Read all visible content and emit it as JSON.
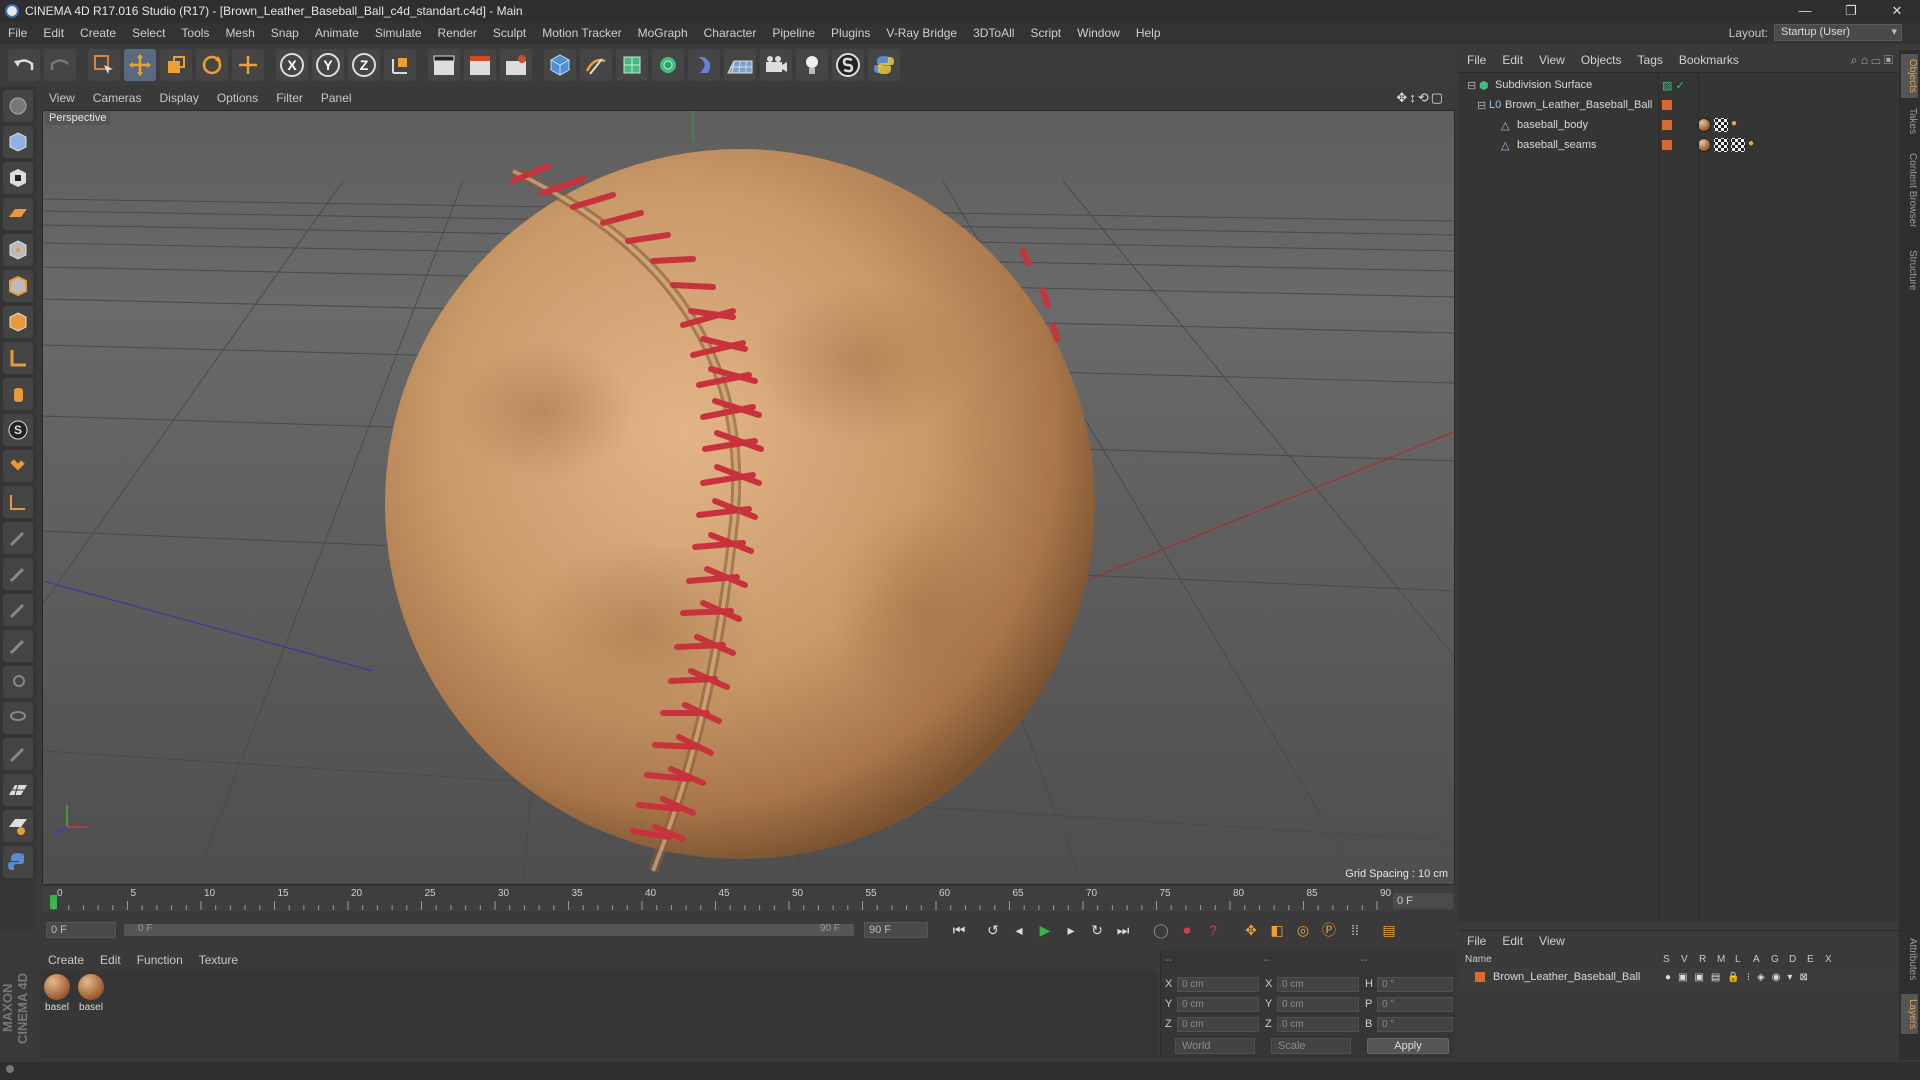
{
  "window": {
    "title": "CINEMA 4D R17.016 Studio (R17) - [Brown_Leather_Baseball_Ball_c4d_standart.c4d] - Main",
    "controls": [
      "—",
      "❐",
      "✕"
    ]
  },
  "menubar": {
    "items": [
      "File",
      "Edit",
      "Create",
      "Select",
      "Tools",
      "Mesh",
      "Snap",
      "Animate",
      "Simulate",
      "Render",
      "Sculpt",
      "Motion Tracker",
      "MoGraph",
      "Character",
      "Pipeline",
      "Plugins",
      "V-Ray Bridge",
      "3DToAll",
      "Script",
      "Window",
      "Help"
    ],
    "layout_label": "Layout:",
    "layout_value": "Startup (User)"
  },
  "toolbar": {
    "axis_x": "X",
    "axis_y": "Y",
    "axis_z": "Z"
  },
  "viewport": {
    "menu": [
      "View",
      "Cameras",
      "Display",
      "Options",
      "Filter",
      "Panel"
    ],
    "label": "Perspective",
    "grid_spacing": "Grid Spacing : 10 cm",
    "nav_icons": "✥↕⟲▢"
  },
  "timeline": {
    "ticks": [
      "0",
      "5",
      "10",
      "15",
      "20",
      "25",
      "30",
      "35",
      "40",
      "45",
      "50",
      "55",
      "60",
      "65",
      "70",
      "75",
      "80",
      "85",
      "90"
    ],
    "current_frame": "0 F",
    "start_field": "0 F",
    "range_start": "0 F",
    "range_end": "90 F",
    "end_field": "90 F"
  },
  "materials": {
    "menu": [
      "Create",
      "Edit",
      "Function",
      "Texture"
    ],
    "items": [
      {
        "name": "basel"
      },
      {
        "name": "basel"
      }
    ],
    "logo_line1": "MAXON",
    "logo_line2": "CINEMA 4D"
  },
  "coordinates": {
    "header": [
      "--",
      "--",
      "--"
    ],
    "rows": [
      {
        "a": "X",
        "a_val": "0 cm",
        "b": "X",
        "b_val": "0 cm",
        "c": "H",
        "c_val": "0 °"
      },
      {
        "a": "Y",
        "a_val": "0 cm",
        "b": "Y",
        "b_val": "0 cm",
        "c": "P",
        "c_val": "0 °"
      },
      {
        "a": "Z",
        "a_val": "0 cm",
        "b": "Z",
        "b_val": "0 cm",
        "c": "B",
        "c_val": "0 °"
      }
    ],
    "mode_dropdown": "World",
    "scale_dropdown": "Scale",
    "apply": "Apply"
  },
  "object_manager": {
    "menu": [
      "File",
      "Edit",
      "View",
      "Objects",
      "Tags",
      "Bookmarks"
    ],
    "objects": [
      {
        "name": "Subdivision Surface",
        "indent": 0
      },
      {
        "name": "Brown_Leather_Baseball_Ball",
        "indent": 1
      },
      {
        "name": "baseball_body",
        "indent": 2
      },
      {
        "name": "baseball_seams",
        "indent": 2
      }
    ]
  },
  "layer_manager": {
    "menu": [
      "File",
      "Edit",
      "View"
    ],
    "columns": [
      "Name",
      "S",
      "V",
      "R",
      "M",
      "L",
      "A",
      "G",
      "D",
      "E",
      "X"
    ],
    "row_name": "Brown_Leather_Baseball_Ball"
  },
  "side_tabs": [
    "Objects",
    "Takes",
    "Content Browser",
    "Structure",
    "Attributes",
    "Layers"
  ],
  "colors": {
    "accent_orange": "#e6a94b",
    "layer_color": "#d96a2b",
    "leather_tan": "#c99a6a",
    "seam_red": "#c8323c",
    "keyframe_green": "#37b34a"
  }
}
